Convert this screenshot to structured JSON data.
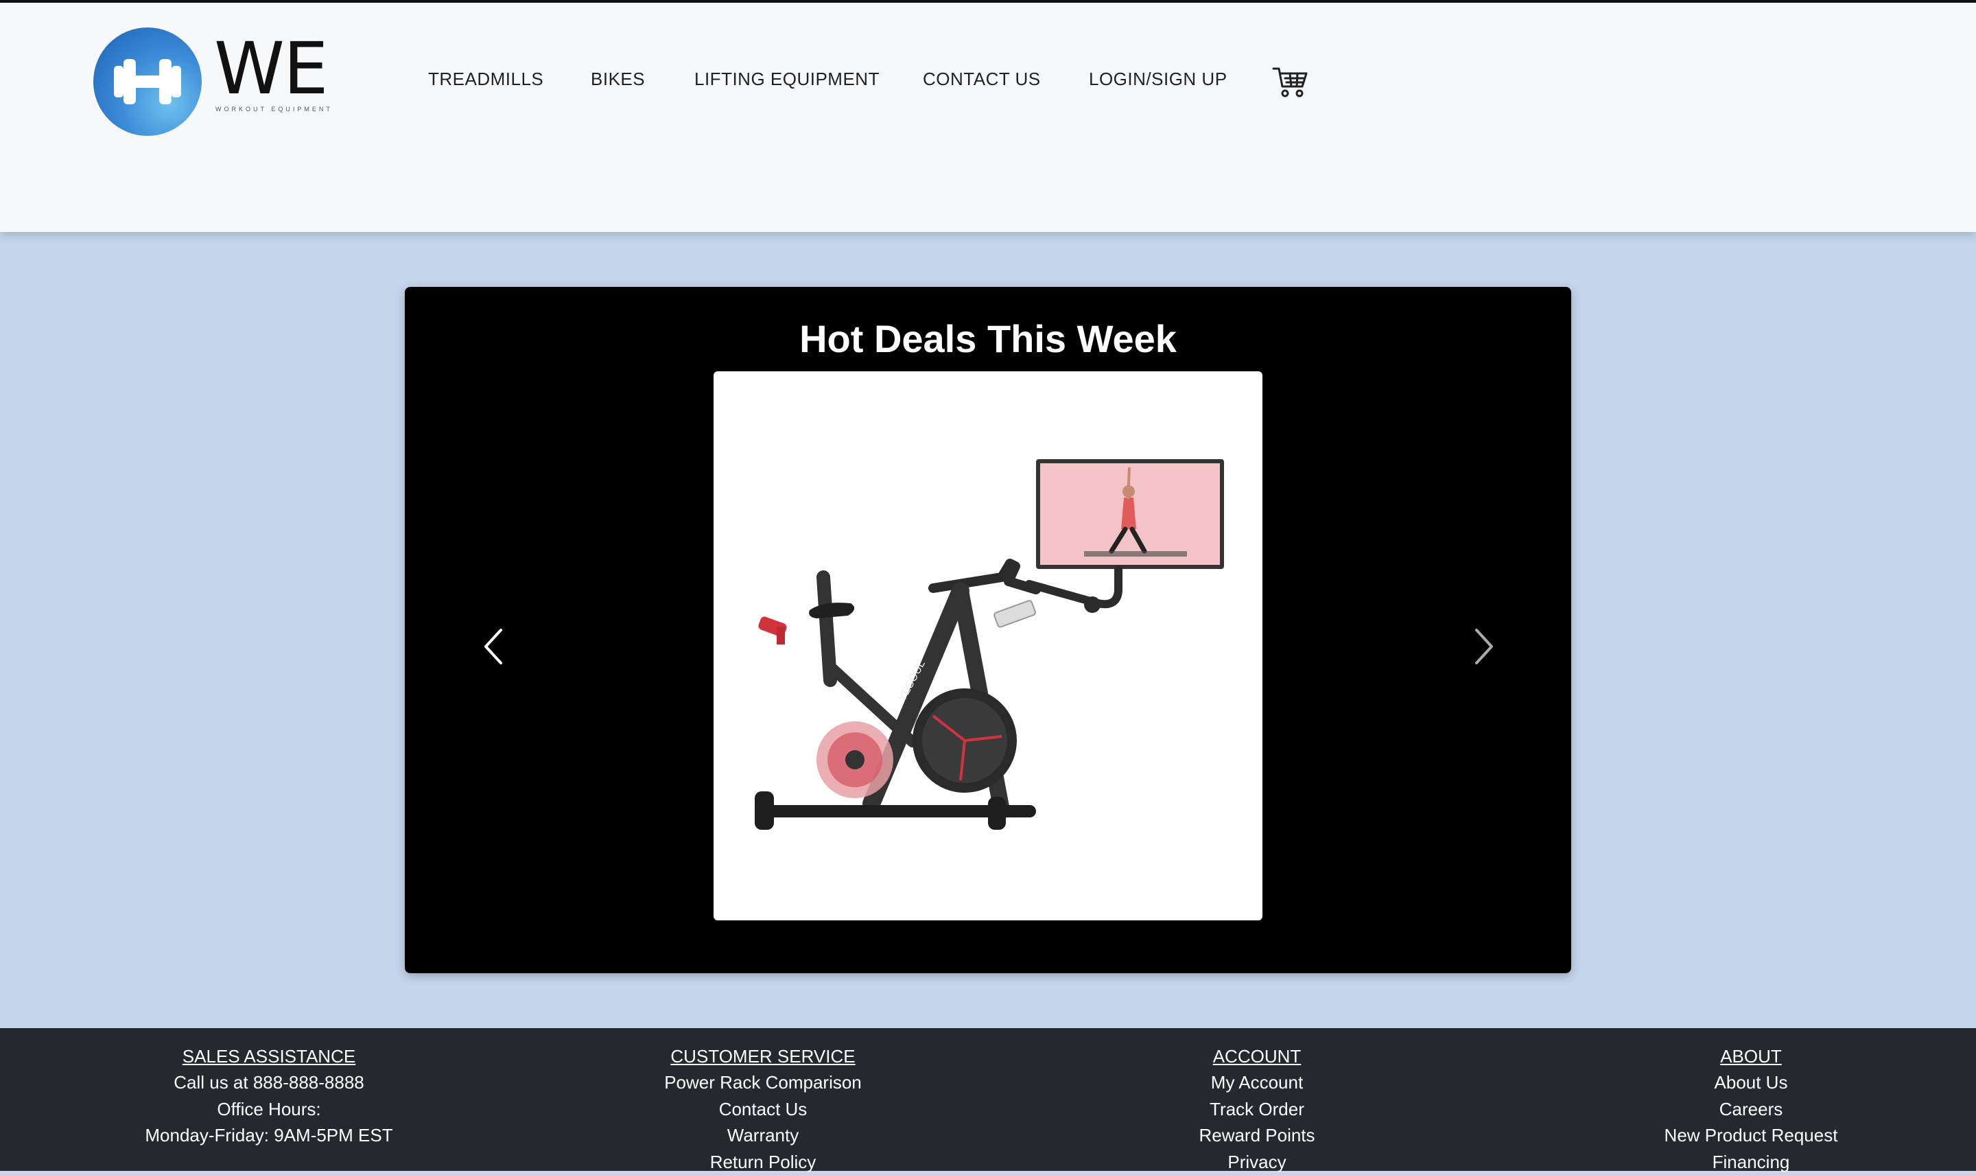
{
  "brand": {
    "name": "WE",
    "tagline": "WORKOUT EQUIPMENT",
    "logo_icon": "dumbbell-icon",
    "accent": "#2f7fd0"
  },
  "nav": {
    "items": [
      {
        "label": "TREADMILLS"
      },
      {
        "label": "BIKES"
      },
      {
        "label": "LIFTING EQUIPMENT"
      },
      {
        "label": "CONTACT US"
      },
      {
        "label": "LOGIN/SIGN UP"
      }
    ],
    "cart_icon": "cart-icon"
  },
  "carousel": {
    "title": "Hot Deals This Week",
    "slide_image": "exercise-bike-with-screen",
    "prev_icon": "chevron-left-icon",
    "next_icon": "chevron-right-icon",
    "product_brand": "YESOUL"
  },
  "footer": {
    "columns": [
      {
        "heading": "SALES ASSISTANCE",
        "lines": [
          "Call us at 888-888-8888",
          "Office Hours:",
          "Monday-Friday: 9AM-5PM EST"
        ]
      },
      {
        "heading": "CUSTOMER SERVICE",
        "lines": [
          "Power Rack Comparison",
          "Contact Us",
          "Warranty",
          "Return Policy"
        ]
      },
      {
        "heading": "ACCOUNT",
        "lines": [
          "My Account",
          "Track Order",
          "Reward Points",
          "Privacy"
        ]
      },
      {
        "heading": "ABOUT",
        "lines": [
          "About Us",
          "Careers",
          "New Product Request",
          "Financing"
        ]
      }
    ]
  },
  "colors": {
    "page_bg": "#c5d6ec",
    "header_bg": "#f7f8fa",
    "footer_bg": "#25282d",
    "carousel_bg": "#000000"
  }
}
